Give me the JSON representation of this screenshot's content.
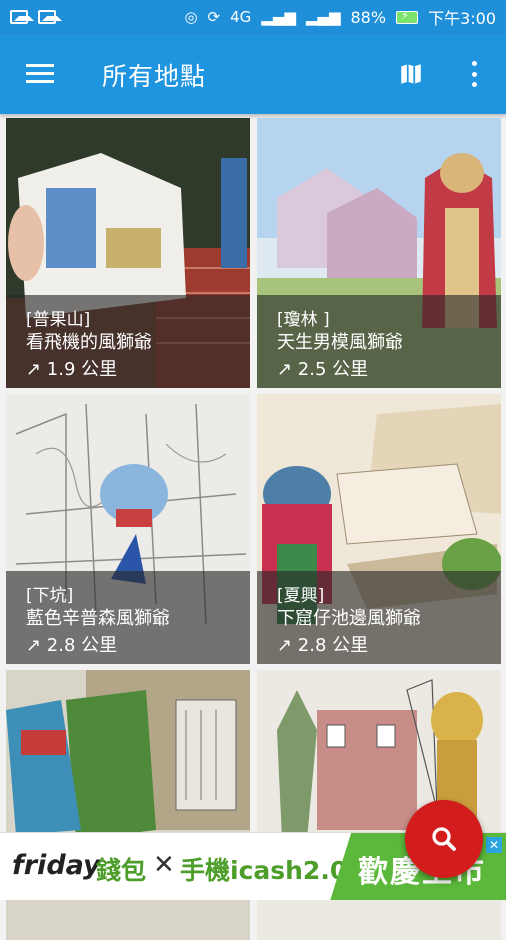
{
  "status_bar": {
    "battery": "88%",
    "time": "下午3:00",
    "signal_4g": "4G"
  },
  "app_bar": {
    "title": "所有地點"
  },
  "cards": [
    {
      "area": "[普果山]",
      "name": "看飛機的風獅爺",
      "distance": "↗ 1.9 公里"
    },
    {
      "area": "[瓊林 ]",
      "name": "天生男模風獅爺",
      "distance": "↗ 2.5 公里"
    },
    {
      "area": "[下坑]",
      "name": "藍色辛普森風獅爺",
      "distance": "↗ 2.8 公里"
    },
    {
      "area": "[夏興]",
      "name": "下窟仔池邊風獅爺",
      "distance": "↗ 2.8 公里"
    },
    {
      "area": "",
      "name": "",
      "distance": ""
    },
    {
      "area": "",
      "name": "",
      "distance": ""
    }
  ],
  "ad": {
    "brand": "friday",
    "wallet": "錢包",
    "times": "✕",
    "phone": "手機icash2.0",
    "promo": "歡慶上市",
    "close": "✕"
  },
  "colors": {
    "primary": "#1f95e0",
    "fab": "#d31d1d",
    "ad_green": "#5cb83a"
  }
}
